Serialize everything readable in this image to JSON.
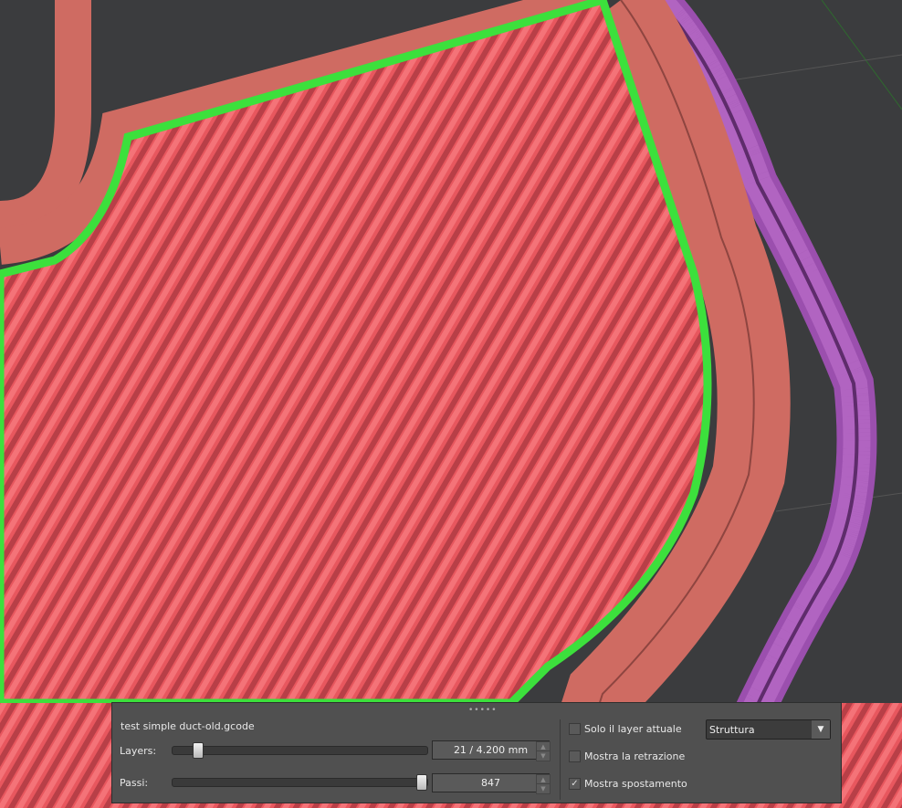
{
  "viewer": {
    "colors": {
      "background": "#3b3c3e",
      "infill": "#e8575e",
      "outline": "#3ce03c",
      "perimeter": "#cf6b62",
      "travel": "#9b4fae"
    }
  },
  "panel": {
    "grip": "•••••",
    "filename": "test simple duct-old.gcode",
    "layers": {
      "label": "Layers:",
      "value": "21 / 4.200 mm",
      "slider_fraction": 0.07
    },
    "steps": {
      "label": "Passi:",
      "value": "847",
      "slider_fraction": 1.0
    },
    "options": [
      {
        "label": "Solo il layer attuale",
        "checked": false,
        "mark": ""
      },
      {
        "label": "Mostra la retrazione",
        "checked": false,
        "mark": ""
      },
      {
        "label": "Mostra spostamento",
        "checked": true,
        "mark": "✓"
      }
    ],
    "view_mode": {
      "selected": "Struttura",
      "arrow": "▼"
    },
    "spin_up": "▲",
    "spin_down": "▼"
  }
}
